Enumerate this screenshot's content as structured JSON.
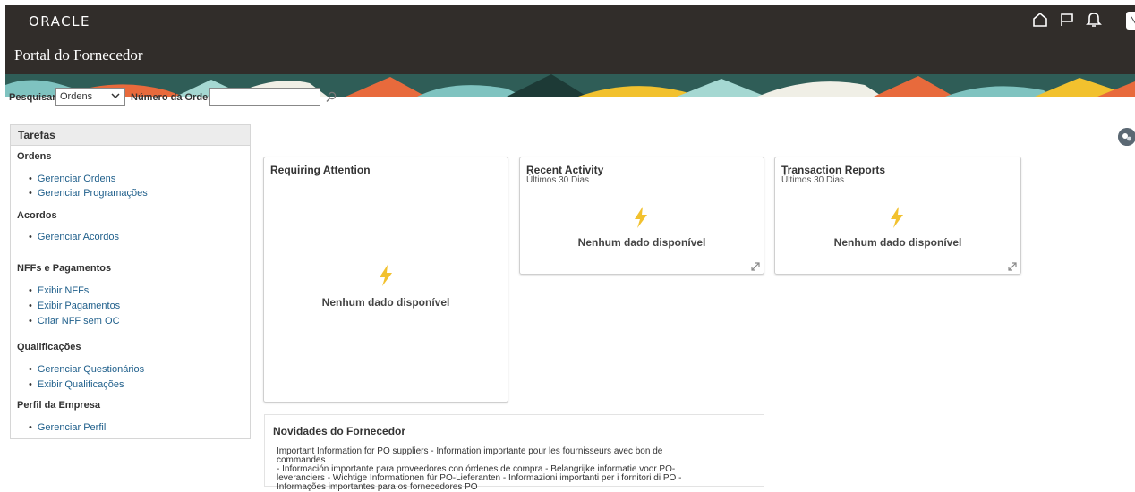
{
  "header": {
    "logo": "ORACLE",
    "portal_title": "Portal do Fornecedor",
    "avatar_initial": "N",
    "icons": [
      "home-icon",
      "flag-icon",
      "bell-icon"
    ]
  },
  "search": {
    "label": "Pesquisar",
    "selected": "Ordens",
    "field_label": "Número da Ordem",
    "value": "",
    "placeholder": ""
  },
  "tasks": {
    "title": "Tarefas",
    "sections": [
      {
        "title": "Ordens",
        "links": [
          "Gerenciar Ordens",
          "Gerenciar Programações"
        ]
      },
      {
        "title": "Acordos",
        "links": [
          "Gerenciar Acordos"
        ]
      },
      {
        "title": "NFFs e Pagamentos",
        "links": [
          "Exibir NFFs",
          "Exibir Pagamentos",
          "Criar NFF sem OC"
        ]
      },
      {
        "title": "Qualificações",
        "links": [
          "Gerenciar Questionários",
          "Exibir Qualificações"
        ]
      },
      {
        "title": "Perfil da Empresa",
        "links": [
          "Gerenciar Perfil"
        ]
      }
    ]
  },
  "cards": {
    "requiring": {
      "title": "Requiring Attention",
      "empty": "Nenhum dado disponível"
    },
    "recent": {
      "title": "Recent Activity",
      "subtitle": "Últimos 30 Dias",
      "empty": "Nenhum dado disponível"
    },
    "reports": {
      "title": "Transaction Reports",
      "subtitle": "Últimos 30 Dias",
      "empty": "Nenhum dado disponível"
    }
  },
  "news": {
    "title": "Novidades do Fornecedor",
    "lines": [
      "Important Information for PO suppliers - Information importante pour les fournisseurs avec bon de commandes",
      "- Información importante para proveedores con órdenes de compra - Belangrijke informatie voor PO-",
      "leveranciers - Wichtige Informationen für PO-Lieferanten - Informazioni importanti per i fornitori di PO -",
      "Informações importantes para os fornecedores PO"
    ]
  },
  "colors": {
    "header_bg": "#312d2a",
    "link": "#1f5f8b",
    "bolt": "#f2c12e"
  }
}
